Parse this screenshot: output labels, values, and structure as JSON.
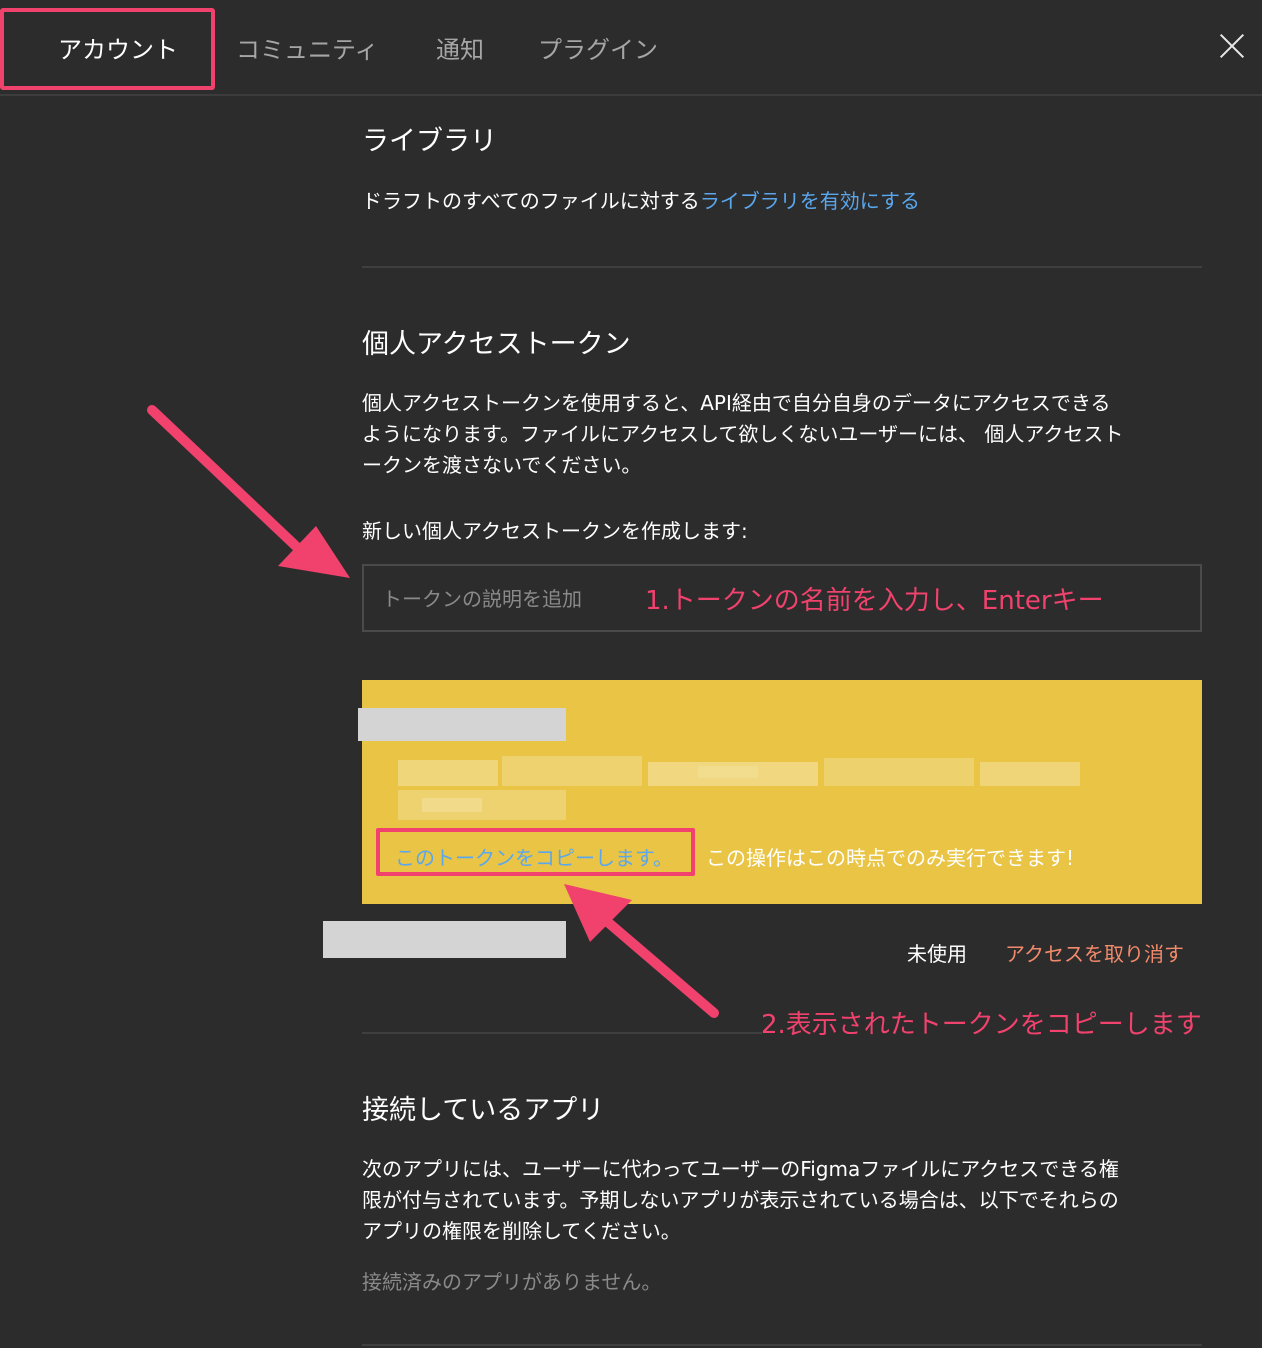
{
  "tabs": [
    {
      "label": "アカウント",
      "active": true
    },
    {
      "label": "コミュニティ",
      "active": false
    },
    {
      "label": "通知",
      "active": false
    },
    {
      "label": "プラグイン",
      "active": false
    }
  ],
  "close_icon": "close-icon",
  "library": {
    "title": "ライブラリ",
    "text": "ドラフトのすべてのファイルに対する",
    "link": "ライブラリを有効にする"
  },
  "pat": {
    "title": "個人アクセストークン",
    "description_lines": [
      "個人アクセストークンを使用すると、API経由で自分自身のデータにアクセスできる",
      "ようになります。ファイルにアクセスして欲しくないユーザーには、 個人アクセスト",
      "ークンを渡さないでください。"
    ],
    "create_label": "新しい個人アクセストークンを作成します:",
    "input_value": "",
    "input_placeholder": "トークンの説明を追加",
    "copy_link": "このトークンをコピーします。",
    "copy_note": "この操作はこの時点でのみ実行できます!",
    "status": "未使用",
    "revoke": "アクセスを取り消す"
  },
  "annotations": {
    "step1": "1.トークンの名前を入力し、Enterキー",
    "step2": "2.表示されたトークンをコピーします"
  },
  "connected_apps": {
    "title": "接続しているアプリ",
    "description_lines": [
      "次のアプリには、ユーザーに代わってユーザーのFigmaファイルにアクセスできる権",
      "限が付与されています。予期しないアプリが表示されている場合は、以下でそれらの",
      "アプリの権限を削除してください。"
    ],
    "empty": "接続済みのアプリがありません。"
  },
  "colors": {
    "background": "#2c2c2c",
    "link": "#5aa7ee",
    "annotation": "#f0426d",
    "token_banner": "#e9c445",
    "revoke": "#f28a6b"
  }
}
